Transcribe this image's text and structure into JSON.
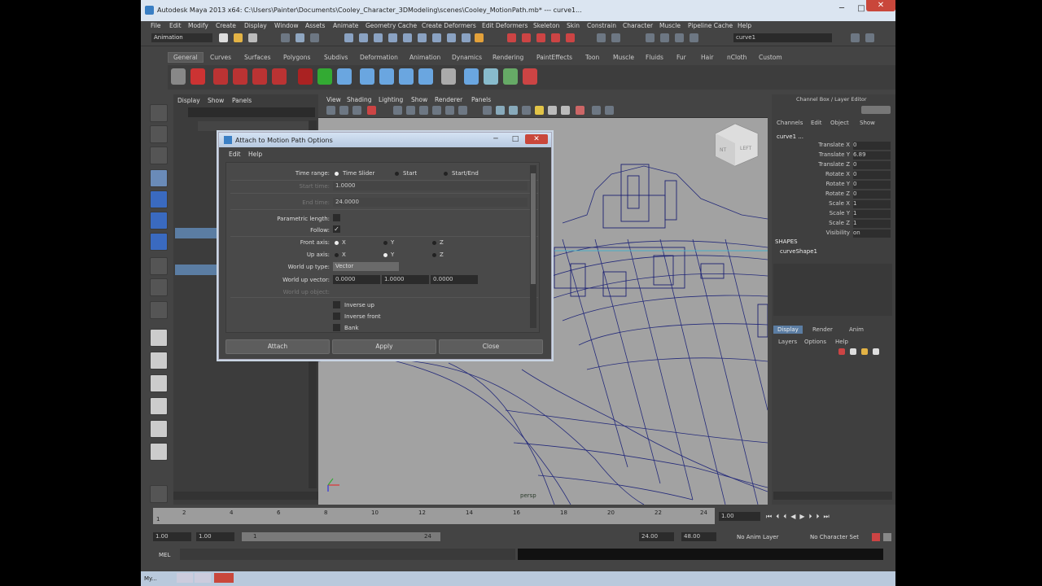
{
  "window": {
    "title": "Autodesk Maya 2013 x64: C:\\Users\\Painter\\Documents\\Cooley_Character_3DModeling\\scenes\\Cooley_MotionPath.mb* --- curve1...",
    "minimize": "─",
    "maximize": "□",
    "close": "✕"
  },
  "menubar": [
    "File",
    "Edit",
    "Modify",
    "Create",
    "Display",
    "Window",
    "Assets",
    "Animate",
    "Geometry Cache",
    "Create Deformers",
    "Edit Deformers",
    "Skeleton",
    "Skin",
    "Constrain",
    "Character",
    "Muscle",
    "Pipeline Cache",
    "Help"
  ],
  "statusline": {
    "mode": "Animation",
    "object_field": "curve1"
  },
  "shelf_tabs": [
    "General",
    "Curves",
    "Surfaces",
    "Polygons",
    "Subdivs",
    "Deformation",
    "Animation",
    "Dynamics",
    "Rendering",
    "PaintEffects",
    "Toon",
    "Muscle",
    "Fluids",
    "Fur",
    "Hair",
    "nCloth",
    "Custom"
  ],
  "outliner": {
    "menu": [
      "Display",
      "Show",
      "Panels"
    ]
  },
  "viewport": {
    "menu": [
      "View",
      "Shading",
      "Lighting",
      "Show",
      "Renderer",
      "Panels"
    ],
    "camera_label": "persp",
    "viewcube_labels": [
      "NT",
      "LEFT"
    ]
  },
  "channel_box": {
    "title": "Channel Box / Layer Editor",
    "menu": [
      "Channels",
      "Edit",
      "Object",
      "Show"
    ],
    "object": "curve1 ...",
    "attributes": [
      {
        "name": "Translate X",
        "value": "0"
      },
      {
        "name": "Translate Y",
        "value": "6.89"
      },
      {
        "name": "Translate Z",
        "value": "0"
      },
      {
        "name": "Rotate X",
        "value": "0"
      },
      {
        "name": "Rotate Y",
        "value": "0"
      },
      {
        "name": "Rotate Z",
        "value": "0"
      },
      {
        "name": "Scale X",
        "value": "1"
      },
      {
        "name": "Scale Y",
        "value": "1"
      },
      {
        "name": "Scale Z",
        "value": "1"
      },
      {
        "name": "Visibility",
        "value": "on"
      }
    ],
    "shapes_header": "SHAPES",
    "shape_name": "curveShape1",
    "layer_tabs": [
      "Display",
      "Render",
      "Anim"
    ],
    "layer_menu": [
      "Layers",
      "Options",
      "Help"
    ]
  },
  "dialog": {
    "title": "Attach to Motion Path Options",
    "menu": [
      "Edit",
      "Help"
    ],
    "time_range_label": "Time range:",
    "time_range_options": [
      "Time Slider",
      "Start",
      "Start/End"
    ],
    "start_time_label": "Start time:",
    "start_time_value": "1.0000",
    "end_time_label": "End time:",
    "end_time_value": "24.0000",
    "parametric_length_label": "Parametric length:",
    "follow_label": "Follow:",
    "follow_check": "✓",
    "front_axis_label": "Front axis:",
    "up_axis_label": "Up axis:",
    "axis_options": [
      "X",
      "Y",
      "Z"
    ],
    "world_up_type_label": "World up type:",
    "world_up_type_value": "Vector",
    "world_up_vector_label": "World up vector:",
    "world_up_vector": [
      "0.0000",
      "1.0000",
      "0.0000"
    ],
    "world_up_object_label": "World up object:",
    "inverse_up_label": "Inverse up",
    "inverse_front_label": "Inverse front",
    "bank_label": "Bank",
    "buttons": {
      "attach": "Attach",
      "apply": "Apply",
      "close": "Close"
    }
  },
  "timeline": {
    "ticks": [
      "1",
      "2",
      "4",
      "6",
      "8",
      "10",
      "12",
      "14",
      "16",
      "18",
      "20",
      "22",
      "24"
    ],
    "current_frame": "1.00"
  },
  "range": {
    "start": "1.00",
    "inner_start": "1.00",
    "slider_start": "1",
    "slider_end": "24",
    "end": "24.00",
    "max": "48.00",
    "anim_layer": "No Anim Layer",
    "character_set": "No Character Set"
  },
  "mel": {
    "label": "MEL"
  },
  "taskbar": {
    "item": "My..."
  }
}
